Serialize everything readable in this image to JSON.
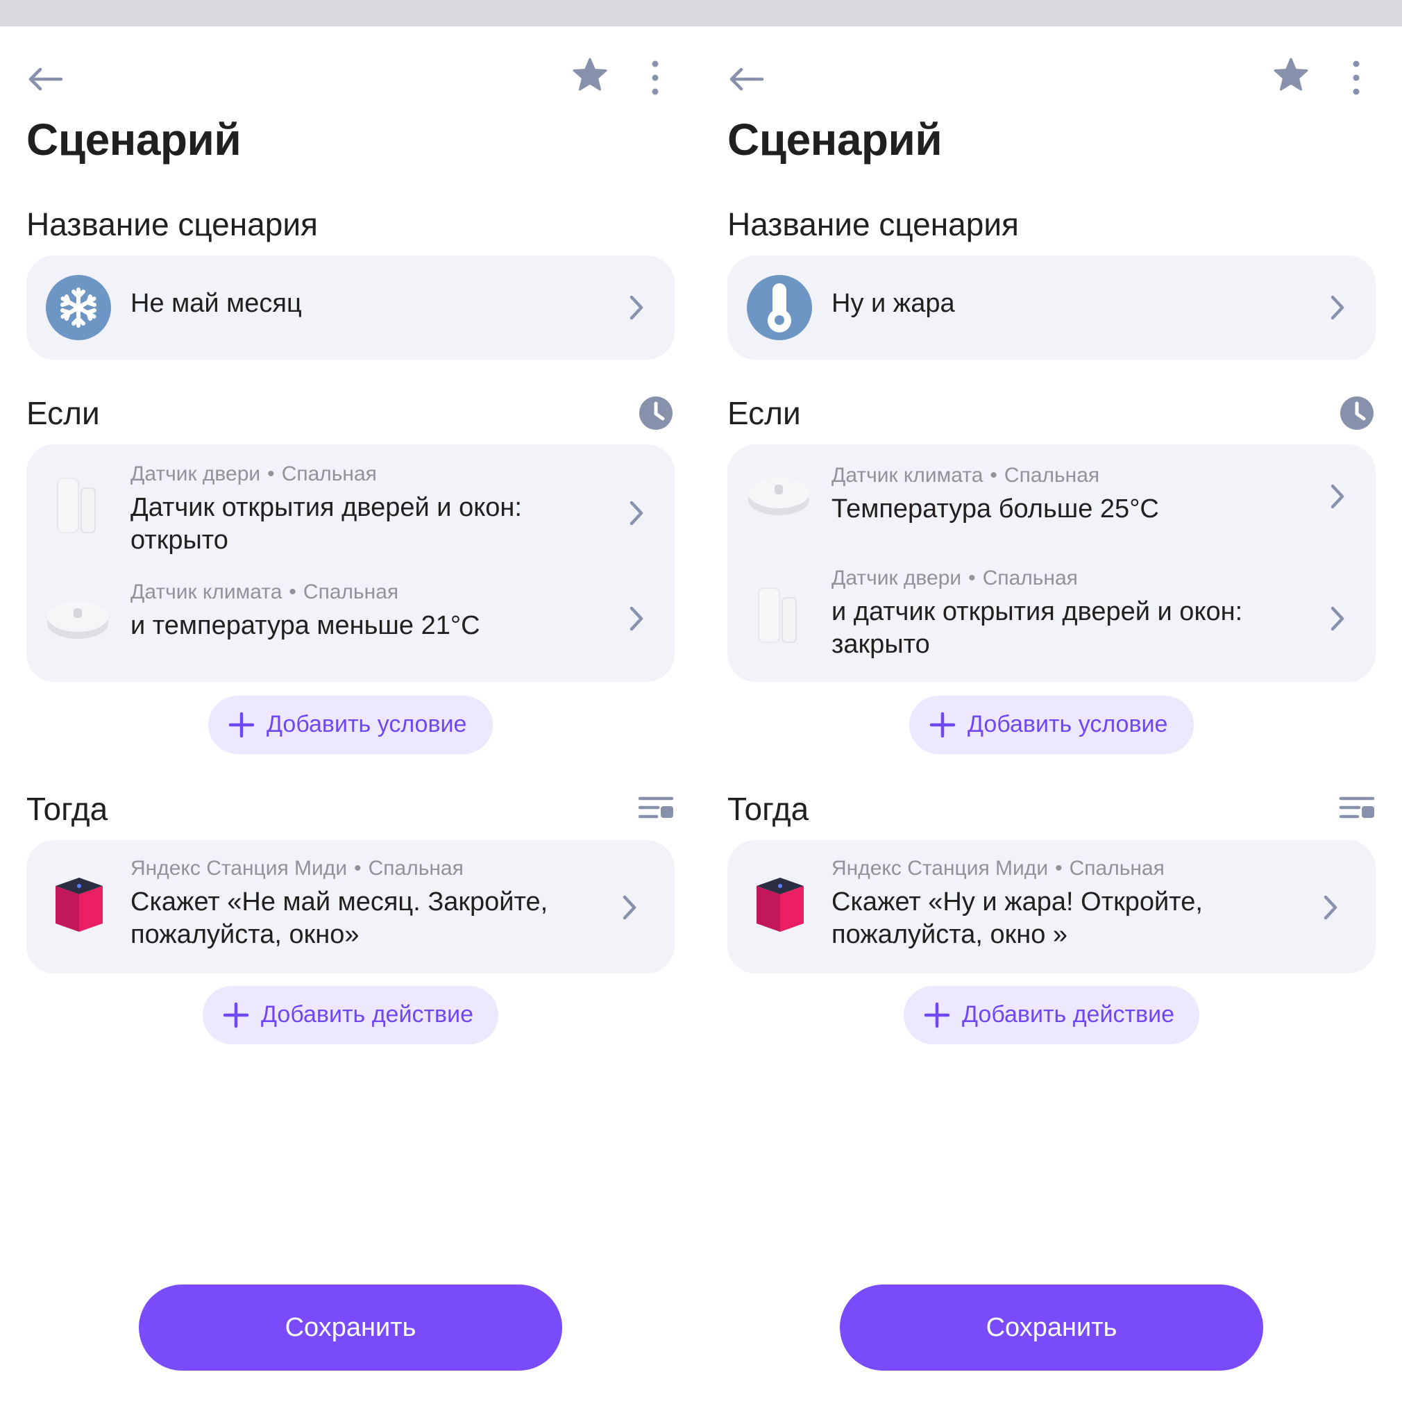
{
  "colors": {
    "accent": "#7a4bfa",
    "pill_bg": "#ede8fd",
    "pill_text": "#7047f5",
    "card_bg": "#f2f2f9",
    "icon_gray": "#8891ab",
    "scenario_icon_bg": "#6d96c4"
  },
  "screens": [
    {
      "title": "Сценарий",
      "name_section": "Название сценария",
      "scenario_name": "Не май месяц",
      "scenario_icon": "snowflake-icon",
      "if_section": "Если",
      "conditions": [
        {
          "device_type": "Датчик двери",
          "room": "Спальная",
          "text": "Датчик открытия дверей и окон: открыто",
          "device_icon": "door-sensor"
        },
        {
          "device_type": "Датчик климата",
          "room": "Спальная",
          "text": "и температура меньше 21°C",
          "device_icon": "climate-sensor"
        }
      ],
      "add_condition": "Добавить условие",
      "then_section": "Тогда",
      "actions": [
        {
          "device_type": "Яндекс Станция Миди",
          "room": "Спальная",
          "text": "Скажет «Не май месяц. Закройте, пожалуйста, окно»",
          "device_icon": "yandex-station-midi"
        }
      ],
      "add_action": "Добавить действие",
      "save": "Сохранить"
    },
    {
      "title": "Сценарий",
      "name_section": "Название сценария",
      "scenario_name": "Ну и жара",
      "scenario_icon": "thermometer-icon",
      "if_section": "Если",
      "conditions": [
        {
          "device_type": "Датчик климата",
          "room": "Спальная",
          "text": "Температура больше 25°C",
          "device_icon": "climate-sensor"
        },
        {
          "device_type": "Датчик двери",
          "room": "Спальная",
          "text": "и датчик открытия дверей и окон: закрыто",
          "device_icon": "door-sensor"
        }
      ],
      "add_condition": "Добавить условие",
      "then_section": "Тогда",
      "actions": [
        {
          "device_type": "Яндекс Станция Миди",
          "room": "Спальная",
          "text": "Скажет «Ну и жара! Откройте, пожалуйста, окно »",
          "device_icon": "yandex-station-midi"
        }
      ],
      "add_action": "Добавить действие",
      "save": "Сохранить"
    }
  ]
}
